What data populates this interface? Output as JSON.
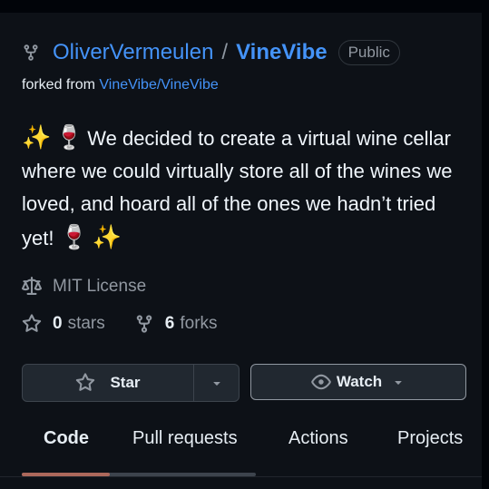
{
  "repo": {
    "owner": "OliverVermeulen",
    "separator": "/",
    "name": "VineVibe",
    "visibility": "Public",
    "forked_prefix": "forked from",
    "forked_source": "VineVibe/VineVibe"
  },
  "description": {
    "lead_emojis": [
      "✨",
      "🍷"
    ],
    "text": "We decided to create a virtual wine cellar where we could virtually store all of the wines we loved, and hoard all of the ones we hadn’t tried yet!",
    "trail_emojis": [
      "🍷",
      "✨"
    ]
  },
  "license": {
    "label": "MIT License",
    "icon": "law-icon"
  },
  "stats": {
    "stars_count": "0",
    "stars_label": "stars",
    "forks_count": "6",
    "forks_label": "forks"
  },
  "actions": {
    "star_label": "Star",
    "watch_label": "Watch"
  },
  "tabs": [
    {
      "label": "Code",
      "active": true
    },
    {
      "label": "Pull requests",
      "active": false
    },
    {
      "label": "Actions",
      "active": false
    },
    {
      "label": "Projects",
      "active": false
    }
  ],
  "colors": {
    "accent_link": "#4493f8",
    "background": "#0d1117",
    "tab_underline": "#f78166"
  }
}
